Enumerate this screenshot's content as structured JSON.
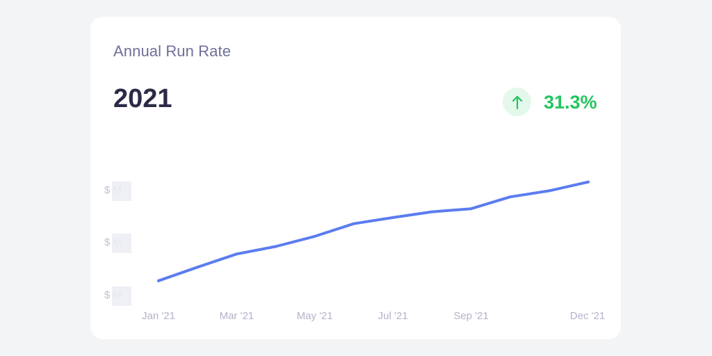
{
  "card": {
    "title": "Annual Run Rate",
    "year": "2021",
    "delta": {
      "value": "31.3%",
      "direction": "up",
      "icon": "arrow-up-icon",
      "color": "#22c55e",
      "badge_color": "#e3f8ea"
    }
  },
  "chart_data": {
    "type": "line",
    "title": "",
    "xlabel": "",
    "ylabel": "",
    "x_tick_labels": [
      "Jan '21",
      "Mar '21",
      "May '21",
      "Jul '21",
      "Sep '21",
      "Dec '21"
    ],
    "y_tick_labels": [
      "$ M",
      "$ M",
      "$ M"
    ],
    "y_labels_redacted": true,
    "grid": false,
    "legend": "none",
    "line_color": "#5b7cf0",
    "series": [
      {
        "x": [
          "Jan '21",
          "Feb '21",
          "Mar '21",
          "Apr '21",
          "May '21",
          "Jun '21",
          "Jul '21",
          "Aug '21",
          "Sep '21",
          "Oct '21",
          "Nov '21",
          "Dec '21"
        ],
        "values": [
          0.18,
          1.03,
          1.85,
          2.32,
          2.95,
          3.74,
          4.12,
          4.48,
          4.67,
          5.41,
          5.79,
          6.34
        ]
      }
    ],
    "ylim": [
      0,
      6.5
    ]
  }
}
